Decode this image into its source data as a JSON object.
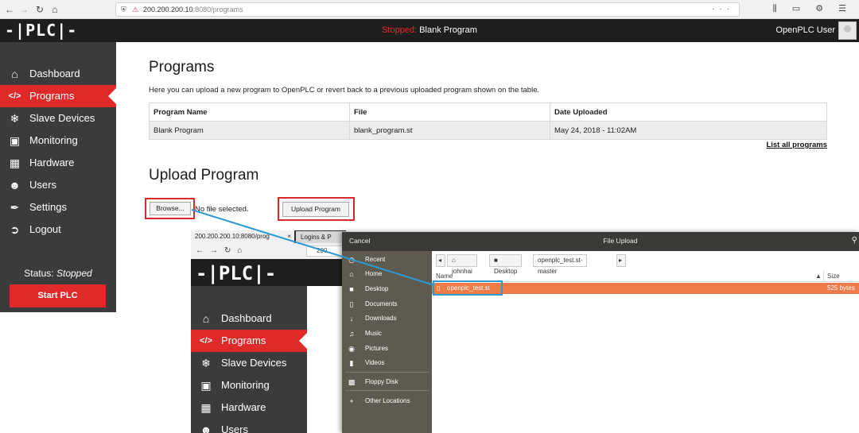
{
  "browser": {
    "url_host": "200.200.200.10",
    "url_rest": ":8080/programs",
    "back_icon": "back-arrow-icon",
    "forward_icon": "forward-arrow-icon",
    "reload_icon": "reload-icon",
    "home_icon": "home-icon",
    "page_actions_glyph": "···",
    "right_icons_glyph": "⫼ ▭ ⚙ ☰"
  },
  "header": {
    "logo": "-|PLC|-",
    "status_state": "Stopped:",
    "program_name": "Blank Program",
    "user_name": "OpenPLC User"
  },
  "sidebar": {
    "items": [
      {
        "label": "Dashboard",
        "icon": "home-icon"
      },
      {
        "label": "Programs",
        "icon": "code-icon"
      },
      {
        "label": "Slave Devices",
        "icon": "gear-cluster-icon"
      },
      {
        "label": "Monitoring",
        "icon": "monitor-icon"
      },
      {
        "label": "Hardware",
        "icon": "chip-icon"
      },
      {
        "label": "Users",
        "icon": "users-icon"
      },
      {
        "label": "Settings",
        "icon": "wrench-icon"
      },
      {
        "label": "Logout",
        "icon": "logout-icon"
      }
    ],
    "status_label": "Status:",
    "status_value": "Stopped",
    "start_button": "Start PLC"
  },
  "main": {
    "title": "Programs",
    "description": "Here you can upload a new program to OpenPLC or revert back to a previous uploaded program shown on the table.",
    "table": {
      "headers": [
        "Program Name",
        "File",
        "Date Uploaded"
      ],
      "rows": [
        [
          "Blank Program",
          "blank_program.st",
          "May 24, 2018 - 11:02AM"
        ]
      ]
    },
    "list_all": "List all programs",
    "upload_title": "Upload Program",
    "browse_button": "Browse...",
    "no_file": "No file selected.",
    "upload_button": "Upload Program"
  },
  "inset": {
    "tab1": "200.200.200.10:8080/prog",
    "tab2": "Logins & P",
    "url": "200",
    "logo": "-|PLC|-",
    "items": [
      {
        "label": "Dashboard",
        "icon": "home-icon"
      },
      {
        "label": "Programs",
        "icon": "code-icon"
      },
      {
        "label": "Slave Devices",
        "icon": "gear-cluster-icon"
      },
      {
        "label": "Monitoring",
        "icon": "monitor-icon"
      },
      {
        "label": "Hardware",
        "icon": "chip-icon"
      },
      {
        "label": "Users",
        "icon": "users-icon"
      }
    ]
  },
  "dialog": {
    "cancel": "Cancel",
    "title": "File Upload",
    "places": [
      {
        "label": "Recent",
        "icon": "clock-icon"
      },
      {
        "label": "Home",
        "icon": "home-icon"
      },
      {
        "label": "Desktop",
        "icon": "folder-icon"
      },
      {
        "label": "Documents",
        "icon": "document-icon"
      },
      {
        "label": "Downloads",
        "icon": "download-icon"
      },
      {
        "label": "Music",
        "icon": "music-icon"
      },
      {
        "label": "Pictures",
        "icon": "camera-icon"
      },
      {
        "label": "Videos",
        "icon": "video-icon"
      },
      {
        "label": "Floppy Disk",
        "icon": "floppy-icon"
      },
      {
        "label": "Other Locations",
        "icon": "plus-icon"
      }
    ],
    "crumbs": [
      "johnhai",
      "Desktop",
      "openplc_test.st-master"
    ],
    "col_name": "Name",
    "col_size": "Size",
    "file_name": "openplc_test.st",
    "file_size": "525 bytes"
  },
  "colors": {
    "accent_red": "#e02a2a",
    "highlight_blue": "#2b9ad2",
    "file_selection": "#ee7a47"
  }
}
